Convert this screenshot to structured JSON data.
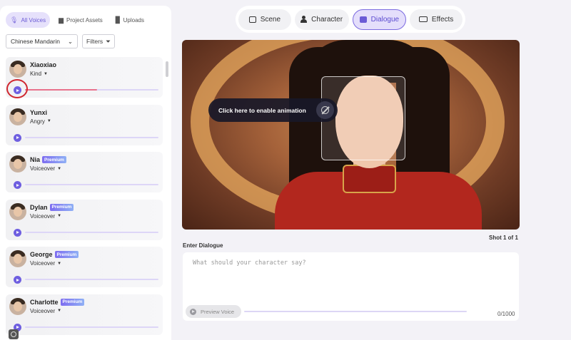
{
  "left_panel": {
    "tabs": [
      {
        "label": "All Voices",
        "active": true
      },
      {
        "label": "Project Assets",
        "active": false
      },
      {
        "label": "Uploads",
        "active": false
      }
    ],
    "language": "Chinese Mandarin",
    "filters_label": "Filters",
    "voices": [
      {
        "name": "Xiaoxiao",
        "style": "Kind",
        "premium": false,
        "progress": 0.54
      },
      {
        "name": "Yunxi",
        "style": "Angry",
        "premium": false,
        "progress": 0
      },
      {
        "name": "Nia",
        "style": "Voiceover",
        "premium": true,
        "progress": 0
      },
      {
        "name": "Dylan",
        "style": "Voiceover",
        "premium": true,
        "progress": 0
      },
      {
        "name": "George",
        "style": "Voiceover",
        "premium": true,
        "progress": 0
      },
      {
        "name": "Charlotte",
        "style": "Voiceover",
        "premium": true,
        "progress": 0
      }
    ],
    "premium_label": "Premium"
  },
  "top_tabs": [
    {
      "label": "Scene",
      "icon": "image-icon",
      "active": false
    },
    {
      "label": "Character",
      "icon": "person-icon",
      "active": false
    },
    {
      "label": "Dialogue",
      "icon": "chat-icon",
      "active": true
    },
    {
      "label": "Effects",
      "icon": "camera-icon",
      "active": false
    }
  ],
  "preview": {
    "animation_prompt": "Click here to enable animation",
    "shot_label": "Shot 1 of 1"
  },
  "dialogue": {
    "label": "Enter Dialogue",
    "placeholder": "What should your character say?",
    "preview_button": "Preview Voice",
    "char_count": "0/1000"
  },
  "colors": {
    "accent": "#6f5fe0",
    "accent_light": "#e4defb",
    "annotation_red": "#d0272f",
    "progress_pink": "#e8728c"
  }
}
